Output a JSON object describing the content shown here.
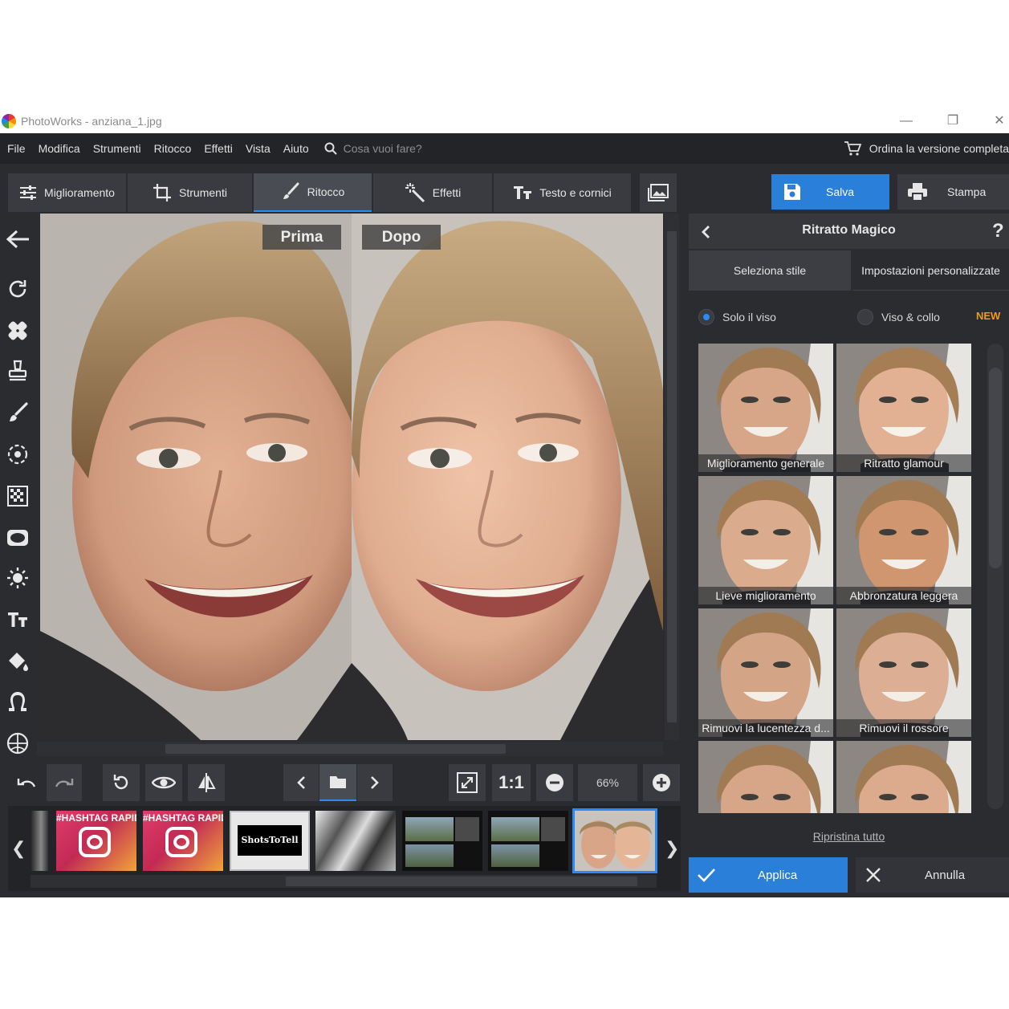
{
  "window": {
    "title": "PhotoWorks - anziana_1.jpg"
  },
  "menu": {
    "items": [
      "File",
      "Modifica",
      "Strumenti",
      "Ritocco",
      "Effetti",
      "Vista",
      "Aiuto"
    ],
    "search_placeholder": "Cosa vuoi fare?",
    "order_label": "Ordina la versione completa"
  },
  "tabs": [
    {
      "label": "Miglioramento",
      "icon": "sliders-icon",
      "active": false
    },
    {
      "label": "Strumenti",
      "icon": "crop-icon",
      "active": false
    },
    {
      "label": "Ritocco",
      "icon": "brush-icon",
      "active": true
    },
    {
      "label": "Effetti",
      "icon": "magic-wand-icon",
      "active": false
    },
    {
      "label": "Testo e cornici",
      "icon": "text-icon",
      "active": false
    }
  ],
  "actions": {
    "save_label": "Salva",
    "print_label": "Stampa"
  },
  "canvas": {
    "before_label": "Prima",
    "after_label": "Dopo"
  },
  "zoom": {
    "one_to_one": "1:1",
    "value": "66%"
  },
  "panel": {
    "title": "Ritratto Magico",
    "help": "?",
    "style_tabs": [
      "Seleziona stile",
      "Impostazioni personalizzate"
    ],
    "scope_options": [
      {
        "label": "Solo il viso",
        "selected": true
      },
      {
        "label": "Viso & collo",
        "selected": false
      }
    ],
    "new_badge": "NEW",
    "styles": [
      {
        "label": "Miglioramento generale"
      },
      {
        "label": "Ritratto glamour"
      },
      {
        "label": "Lieve miglioramento"
      },
      {
        "label": "Abbronzatura leggera"
      },
      {
        "label": "Rimuovi la lucentezza d..."
      },
      {
        "label": "Rimuovi il rossore"
      },
      {
        "label": ""
      },
      {
        "label": ""
      }
    ],
    "reset_label": "Ripristina tutto",
    "apply_label": "Applica",
    "cancel_label": "Annulla"
  },
  "filmstrip": {
    "thumbnails": [
      {
        "caption": "#HASHTAG RAPIDI Instagram"
      },
      {
        "caption": "#HASHTAG RAPIDI Instagram"
      },
      {
        "caption": "ShotsToTell"
      }
    ]
  },
  "colors": {
    "accent": "#2a7fd8",
    "badge": "#f39c12",
    "bg": "#2b2c30"
  }
}
